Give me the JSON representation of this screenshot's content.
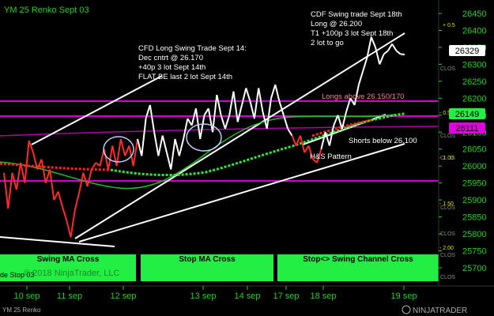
{
  "window": {
    "title": "YM 25 Renko Sept 03",
    "footer_label": "YM 25 Renko"
  },
  "copyright": "© 2018 NinjaTrader, LLC",
  "branding": {
    "logo": "NINJATRADER"
  },
  "colors": {
    "background": "#000000",
    "price_up": "#ffffff",
    "price_down": "#ff2a2a",
    "magenta_lines": "#d400d4",
    "channel": "#ffffff",
    "ma_slow": "#20c020",
    "ma_dotted_up": "#2eea2e",
    "ma_dotted_down": "#ff2020",
    "axis_text": "#1fd21f",
    "label_green_bg": "#22ee44"
  },
  "y_axis": {
    "ticks": [
      "26450",
      "26400",
      "26350",
      "26300",
      "26250",
      "26200",
      "26150",
      "26100",
      "26050",
      "26000",
      "25950",
      "25900",
      "25850",
      "25800",
      "25750",
      "25700"
    ],
    "current_labels": [
      "26329",
      "26149",
      "26111"
    ],
    "minor_labels": [
      "+ 0.5",
      "- 0.5",
      "- 1.00",
      "- 1.50",
      "- 2.00"
    ],
    "clos_labels": [
      "CLOS",
      "CLOS",
      "CLOS",
      "CLOS",
      "CLOS",
      "CLOS",
      "CLOS"
    ]
  },
  "x_axis": {
    "ticks": [
      "10 sep",
      "11 sep",
      "12 sep",
      "13 sep",
      "14 sep",
      "17 sep",
      "18 sep",
      "19 sep"
    ]
  },
  "annotations": [
    {
      "id": "cfd-long",
      "lines": [
        "CFD Long Swing Trade Sept 14:",
        "Dec cntrt @ 26.170",
        "+40p 3 lot Sept 14th",
        "FLAT BE last 2 lot Sept 14th"
      ]
    },
    {
      "id": "cdf-swing",
      "lines": [
        "CDF Swing trade Sept 18th",
        "Long @ 26.200",
        "T1 +100p 3 lot Sept 18th",
        "2 lot to go"
      ]
    },
    {
      "id": "longs-above",
      "lines": [
        "Longs above 26.150/170"
      ]
    },
    {
      "id": "shorts-below",
      "lines": [
        "Shorts below 26.100"
      ]
    },
    {
      "id": "hs-pattern",
      "lines": [
        "H&S Pattern"
      ]
    }
  ],
  "sections": [
    "Swing MA Cross",
    "Stop MA Cross",
    "Stop<> Swing  Channel Cross"
  ],
  "section_left_text": "de Stop 03",
  "chart_data": {
    "type": "line",
    "title": "YM 25 Renko Sept 03",
    "ylim": [
      25700,
      26475
    ],
    "x_ticks": [
      "10 sep",
      "11 sep",
      "12 sep",
      "13 sep",
      "14 sep",
      "17 sep",
      "18 sep",
      "19 sep"
    ],
    "series": [
      {
        "x": [
          0,
          4,
          8,
          12,
          16,
          20,
          24,
          28,
          32,
          36,
          40,
          44,
          48,
          52,
          56,
          60,
          64,
          68,
          72,
          76,
          80,
          84,
          88,
          92,
          96,
          100,
          104,
          108,
          112,
          116,
          120,
          124,
          128,
          132,
          136,
          140,
          144,
          148,
          152,
          156,
          160,
          164,
          168,
          172,
          176,
          180,
          184,
          188,
          192,
          196,
          200,
          204,
          208,
          212,
          216,
          220,
          224,
          228,
          232,
          236,
          240,
          244,
          248,
          252,
          256,
          260,
          264,
          268,
          272,
          276,
          280,
          284,
          288,
          292,
          296,
          300,
          304,
          308,
          312,
          316,
          320,
          324,
          328,
          332,
          336,
          340,
          344,
          348,
          352,
          356,
          360,
          364,
          368,
          372,
          376,
          380,
          384,
          388,
          392,
          396,
          400,
          404,
          408,
          412,
          416,
          420,
          424,
          428,
          432,
          436,
          440,
          444,
          448,
          452,
          456,
          460,
          464,
          468,
          472,
          476,
          480,
          484,
          488,
          492,
          496,
          500,
          504,
          508,
          512
        ],
        "values": [
          25980,
          25875,
          25980,
          25930,
          26010,
          25950,
          26075,
          26040,
          25990,
          26020,
          25950,
          25990,
          25900,
          25925,
          25880,
          25840,
          25790,
          25870,
          25920,
          25980,
          25940,
          25990,
          26010,
          26000,
          26050,
          25990,
          26060,
          26000,
          26080,
          26030,
          26060,
          26000,
          26080,
          26030,
          26140,
          26180,
          26100,
          26030,
          26090,
          26040,
          25990,
          26080,
          26030,
          26080,
          26140,
          26120,
          26170,
          26080,
          26150,
          26170,
          26100,
          26210,
          26150,
          26110,
          26150,
          26220,
          26130,
          26180,
          26230,
          26190,
          26140,
          26230,
          26160,
          26110,
          26200,
          26240,
          26190,
          26150,
          26110,
          26090,
          26060,
          26090,
          26040,
          26060,
          26020,
          26010,
          26050,
          26100,
          26060,
          26120,
          26150,
          26110,
          26160,
          26200,
          26180,
          26240,
          26280,
          26320,
          26380,
          26350,
          26300,
          26330,
          26340,
          26360,
          26340,
          26330,
          26329,
          26329,
          26329,
          26329,
          26329,
          26329,
          26329,
          26329,
          26329,
          26329,
          26329,
          26329,
          26329,
          26329,
          26329,
          26329,
          26329,
          26329,
          26329,
          26329,
          26329,
          26329,
          26329,
          26329,
          26329,
          26329,
          26329,
          26329,
          26329,
          26329,
          26329,
          26329,
          26329
        ]
      }
    ],
    "horizontal_levels": [
      26185,
      26150,
      26100,
      25955
    ],
    "current_price": 26329
  }
}
